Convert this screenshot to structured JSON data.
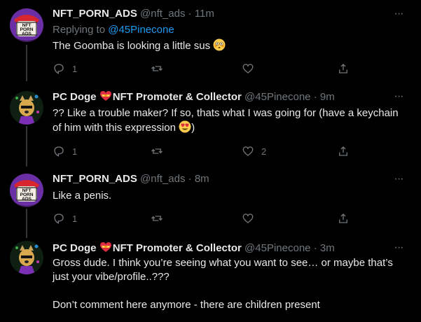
{
  "tweets": [
    {
      "name": "NFT_PORN_ADS",
      "handle": "@nft_ads",
      "time": "11m",
      "replying_label": "Replying to",
      "replying_handle": "@45Pinecone",
      "text": "The Goomba is looking a little sus",
      "text_emoji": "flushed-face",
      "reply_count": "1",
      "retweet_count": "",
      "like_count": ""
    },
    {
      "name": "PC Doge",
      "name_emoji": "heart-with-ribbon",
      "name_suffix": "NFT Promoter & Collector",
      "handle": "@45Pinecone",
      "time": "9m",
      "text_line1": "?? Like a trouble maker? If so, thats what I was going for (have a keychain",
      "text_line2": "of him with this expression",
      "text_emoji": "heart-eyes-face",
      "text_line2_end": ")",
      "reply_count": "1",
      "retweet_count": "",
      "like_count": "2"
    },
    {
      "name": "NFT_PORN_ADS",
      "handle": "@nft_ads",
      "time": "8m",
      "text": "Like a penis.",
      "reply_count": "1",
      "retweet_count": "",
      "like_count": ""
    },
    {
      "name": "PC Doge",
      "name_emoji": "heart-with-ribbon",
      "name_suffix": "NFT Promoter & Collector",
      "handle": "@45Pinecone",
      "time": "3m",
      "text_line1": "Gross dude. I think you’re seeing what you want to see… or maybe that’s",
      "text_line2": "just your vibe/profile..???",
      "text_line3": "Don’t comment here anymore - there are children present"
    }
  ],
  "separator": "·",
  "avatar_logo_text": [
    "NFT",
    "PORN",
    "ADS"
  ],
  "colors": {
    "accent": "#1d9bf0",
    "muted": "#71767b",
    "text": "#e7e9ea",
    "background": "#000000"
  }
}
